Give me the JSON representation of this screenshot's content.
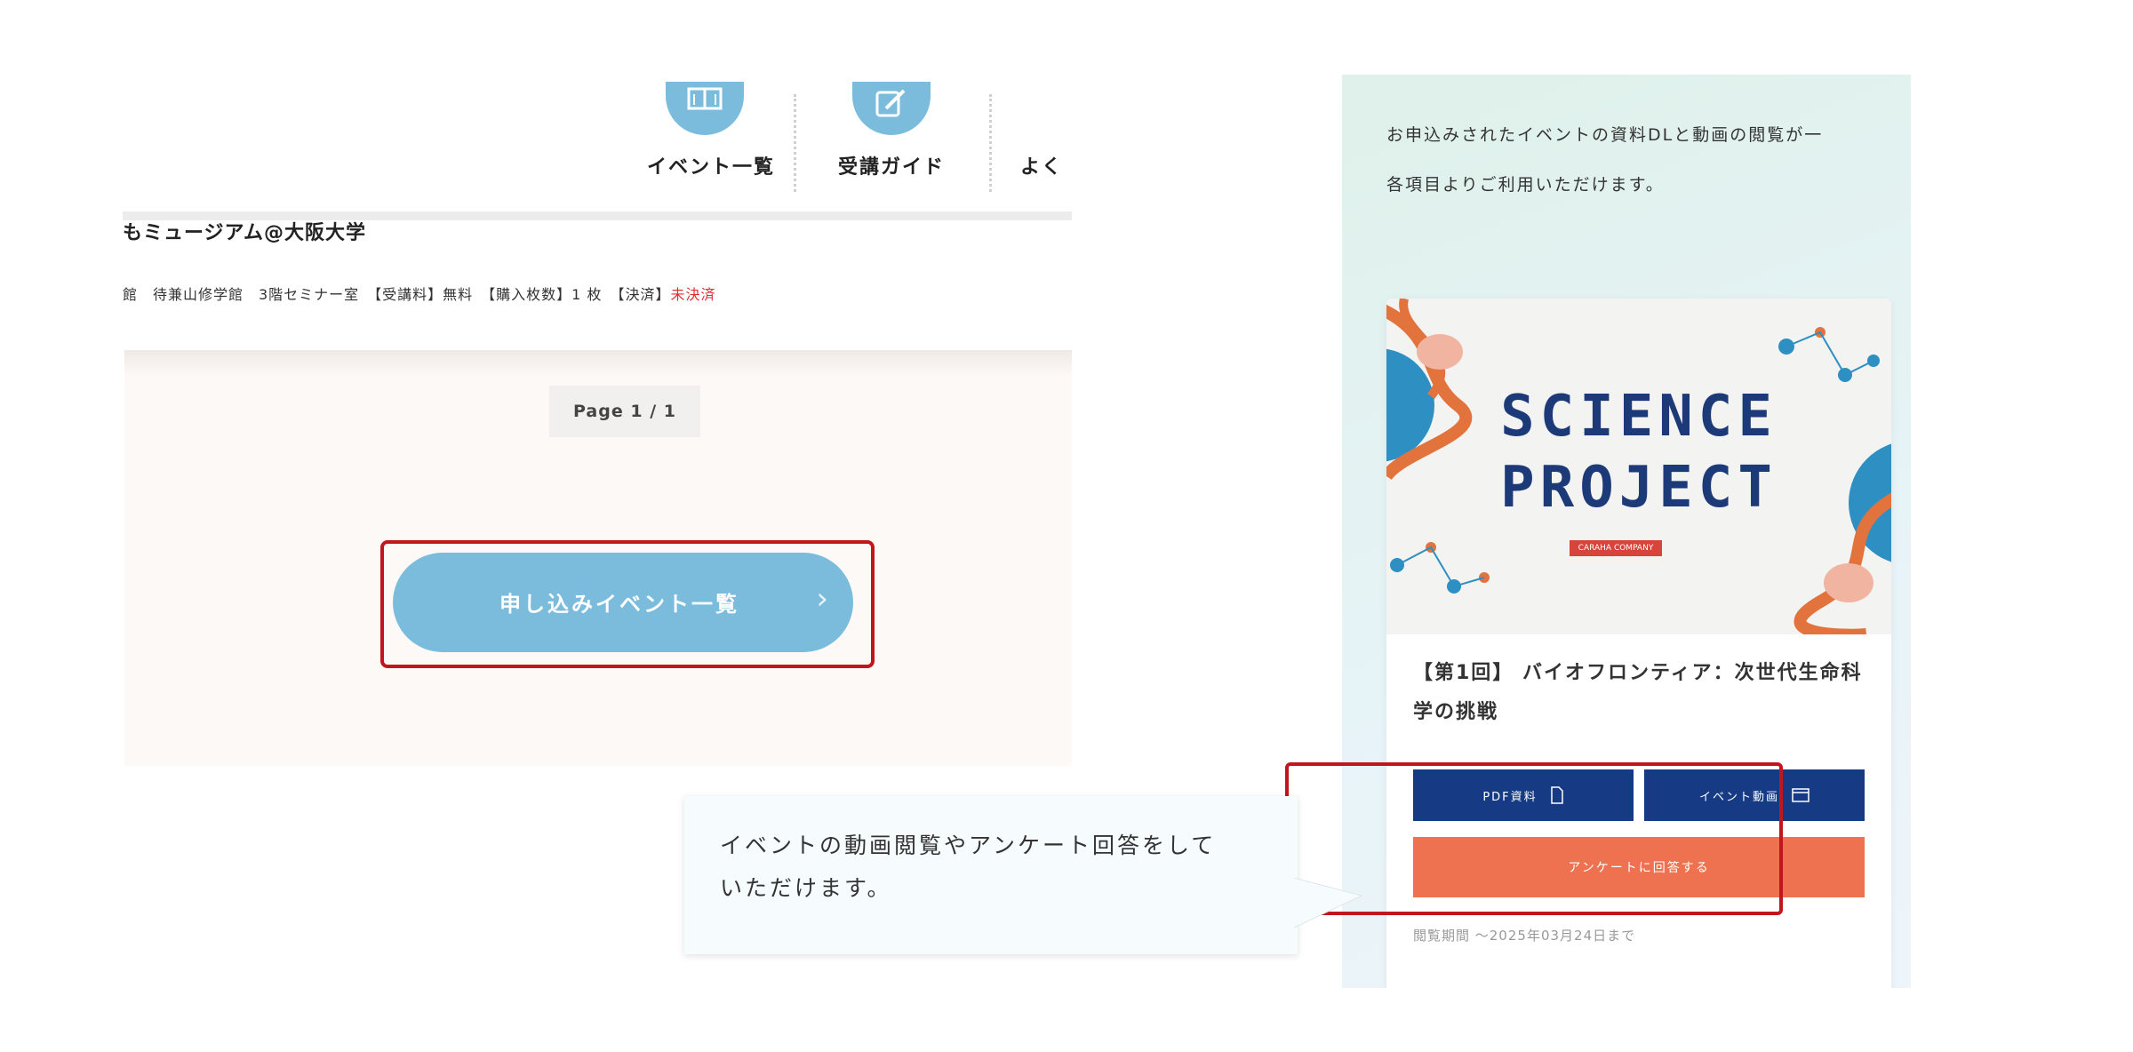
{
  "left_screenshot": {
    "nav": [
      {
        "label": "イベント一覧",
        "icon": "book-icon"
      },
      {
        "label": "受講ガイド",
        "icon": "pencil-icon"
      },
      {
        "label": "よく",
        "icon": "faq-icon"
      }
    ],
    "venue": "もミュージアム@大阪大学",
    "details": {
      "text": "館　待兼山修学館　3階セミナー室　【受講料】無料　【購入枚数】1 枚　【決済】",
      "status": "未決済"
    },
    "pager": "Page 1 / 1",
    "cta_button": "申し込みイベント一覧",
    "cta_chevron": "›"
  },
  "right_screenshot": {
    "intro_lines": [
      "お申込みされたイベントの資料DLと動画の閲覧が一",
      "各項目よりご利用いただけます。"
    ],
    "banner": {
      "line1": "SCIENCE",
      "line2": "PROJECT",
      "tag": "CARAHA COMPANY"
    },
    "event_title": "【第1回】 バイオフロンティア：次世代生命科学の挑戦",
    "buttons": {
      "pdf": "PDF資料",
      "event_video": "イベント動画",
      "survey": "アンケートに回答する"
    },
    "period": "閲覧期間 〜2025年03月24日まで"
  },
  "callout": {
    "text_lines": [
      "イベントの動画閲覧やアンケート回答をして",
      "いただけます。"
    ]
  },
  "colors": {
    "highlight": "#c0161d",
    "pill": "#7bbcdc",
    "navy_button": "#163b84",
    "orange_button": "#ee7150",
    "unpaid": "#e03030"
  }
}
